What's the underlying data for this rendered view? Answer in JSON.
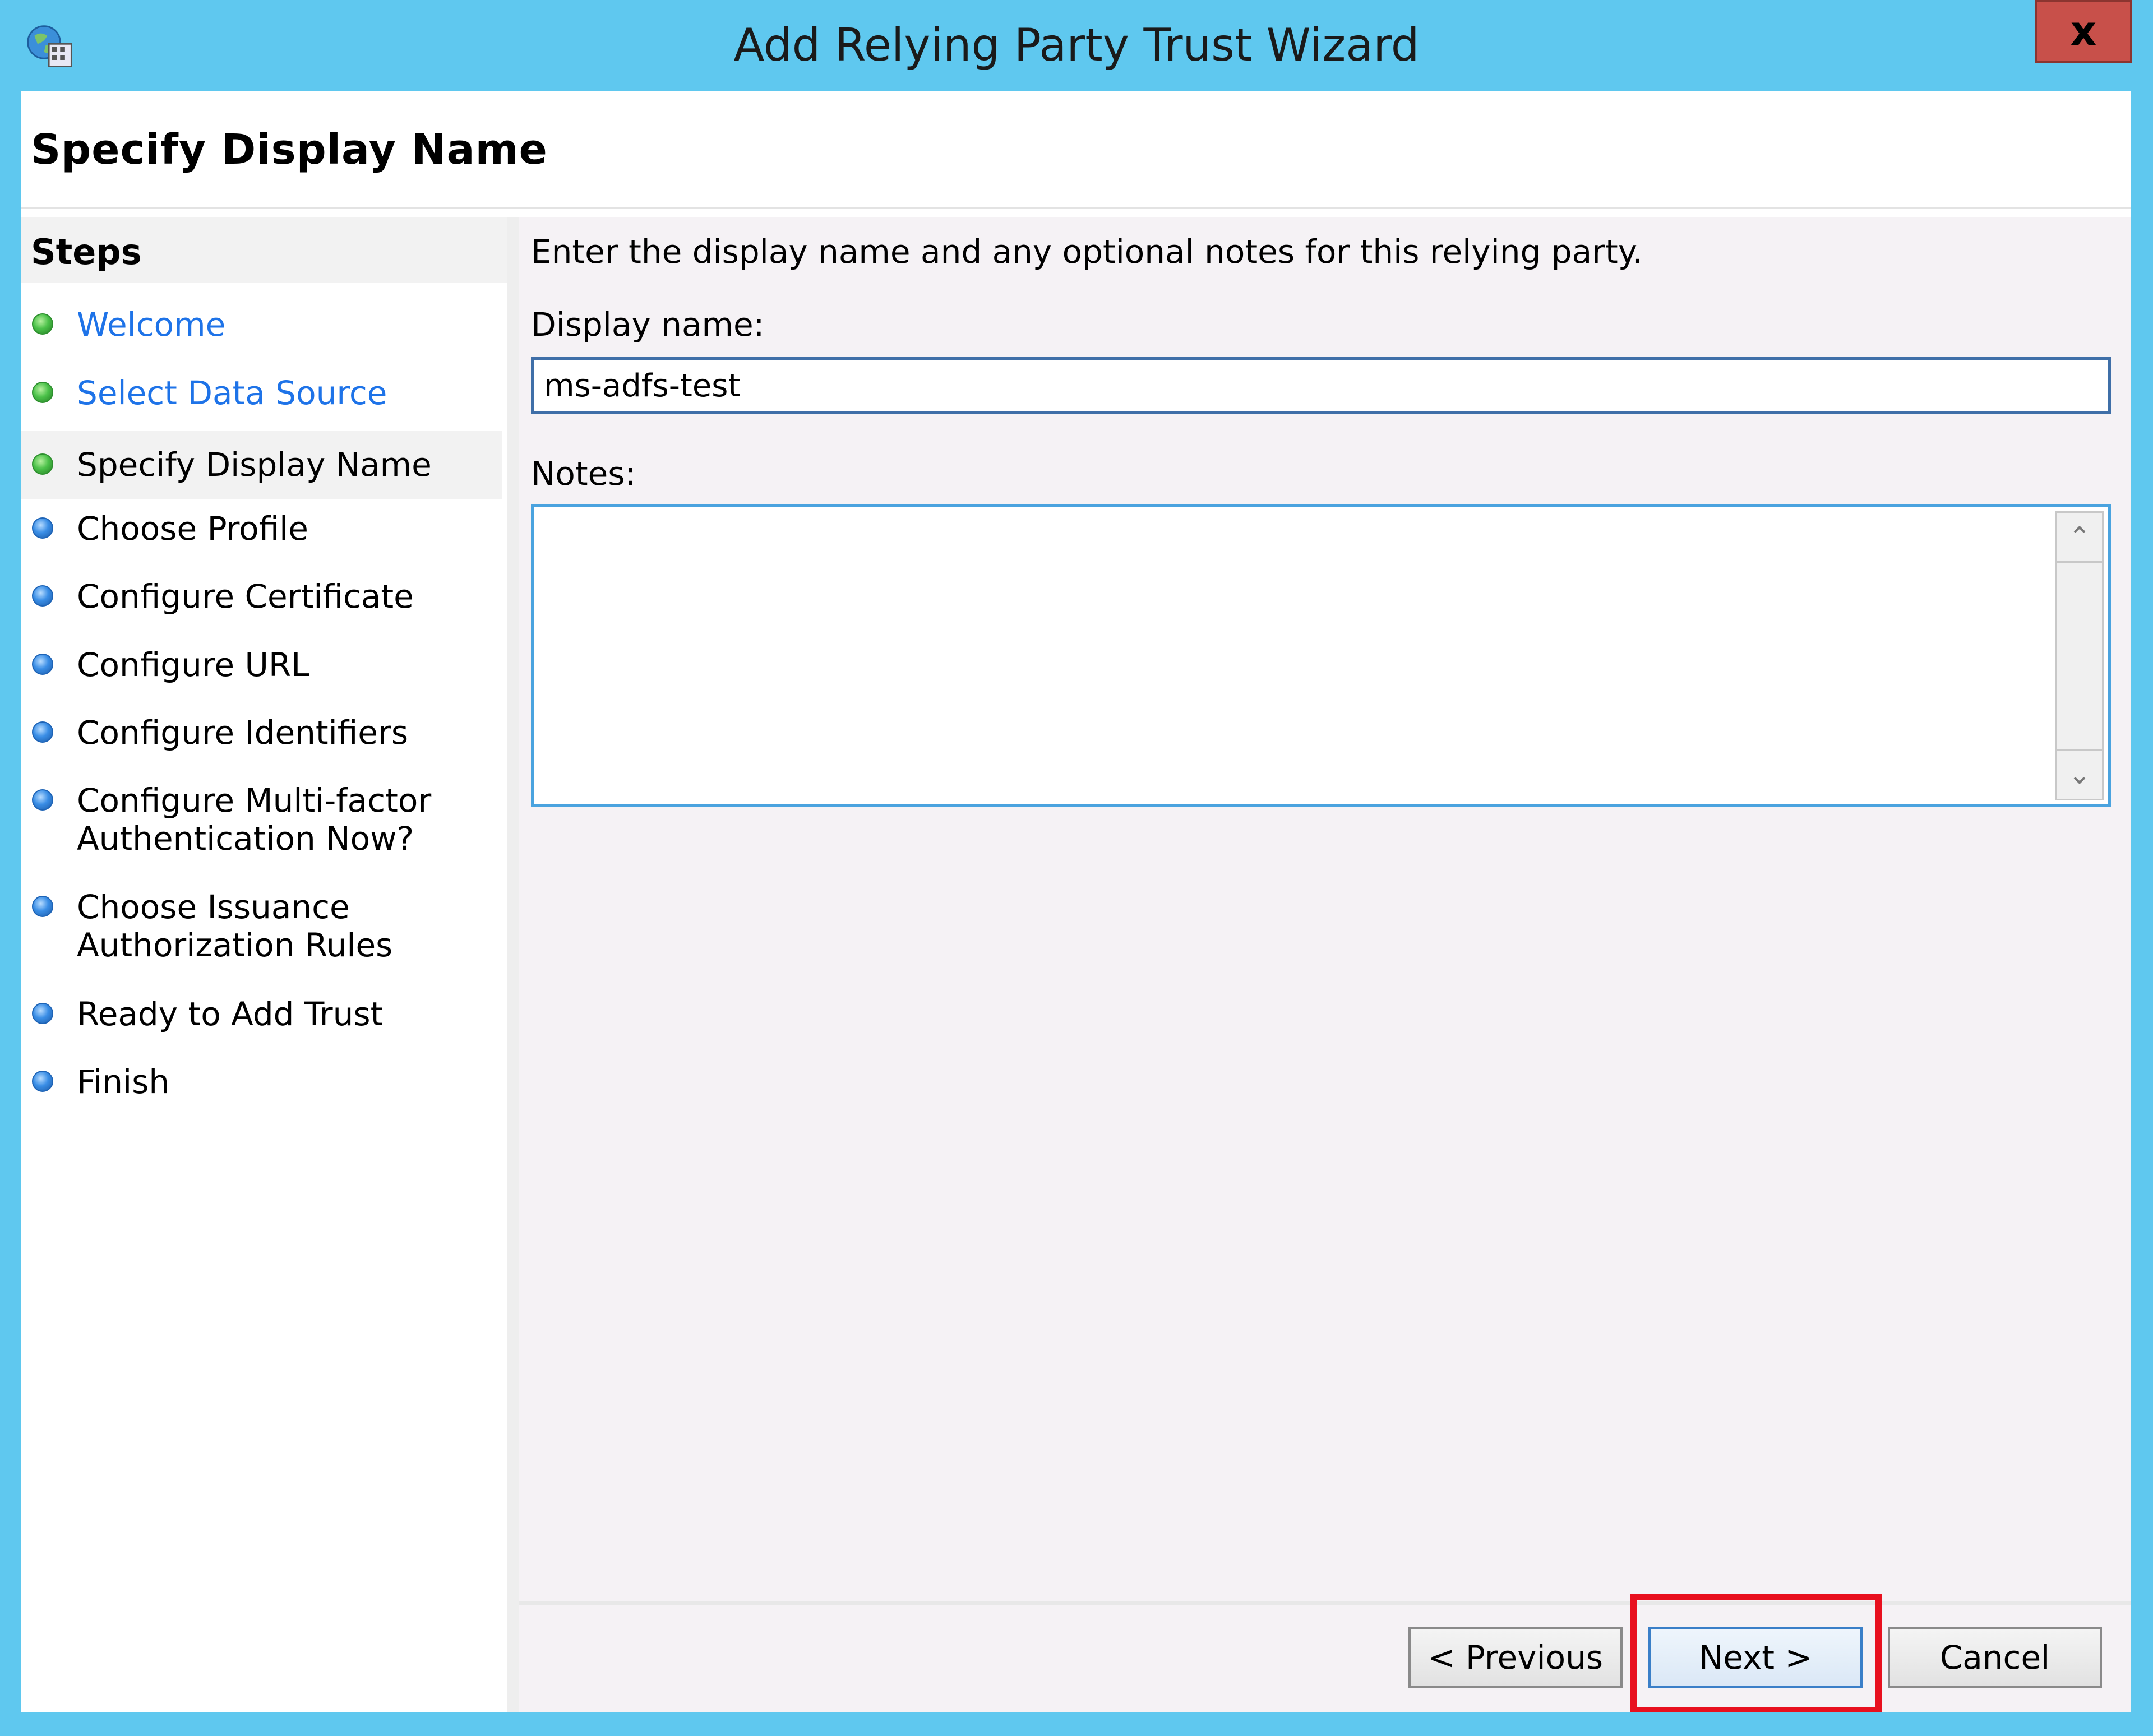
{
  "window": {
    "title": "Add Relying Party Trust Wizard",
    "close_glyph": "x",
    "icon": "adfs-wizard-icon"
  },
  "header": {
    "page_title": "Specify Display Name"
  },
  "sidebar": {
    "heading": "Steps",
    "items": [
      {
        "label": "Welcome",
        "status": "done",
        "link": true
      },
      {
        "label": "Select Data Source",
        "status": "done",
        "link": true
      },
      {
        "label": "Specify Display Name",
        "status": "current",
        "link": false
      },
      {
        "label": "Choose Profile",
        "status": "todo",
        "link": false
      },
      {
        "label": "Configure Certificate",
        "status": "todo",
        "link": false
      },
      {
        "label": "Configure URL",
        "status": "todo",
        "link": false
      },
      {
        "label": "Configure Identifiers",
        "status": "todo",
        "link": false
      },
      {
        "label_line1": "Configure Multi-factor",
        "label_line2": "Authentication Now?",
        "status": "todo",
        "link": false
      },
      {
        "label_line1": "Choose Issuance",
        "label_line2": "Authorization Rules",
        "status": "todo",
        "link": false
      },
      {
        "label": "Ready to Add Trust",
        "status": "todo",
        "link": false
      },
      {
        "label": "Finish",
        "status": "todo",
        "link": false
      }
    ]
  },
  "main": {
    "intro": "Enter the display name and any optional notes for this relying party.",
    "display_name_label": "Display name:",
    "display_name_value": "ms-adfs-test",
    "notes_label": "Notes:",
    "notes_value": ""
  },
  "footer": {
    "previous_label": "< Previous",
    "next_label": "Next >",
    "cancel_label": "Cancel"
  },
  "colors": {
    "frame": "#5fc8ef",
    "link": "#1e73e8",
    "highlight": "#e8101e",
    "close": "#c8504a"
  }
}
